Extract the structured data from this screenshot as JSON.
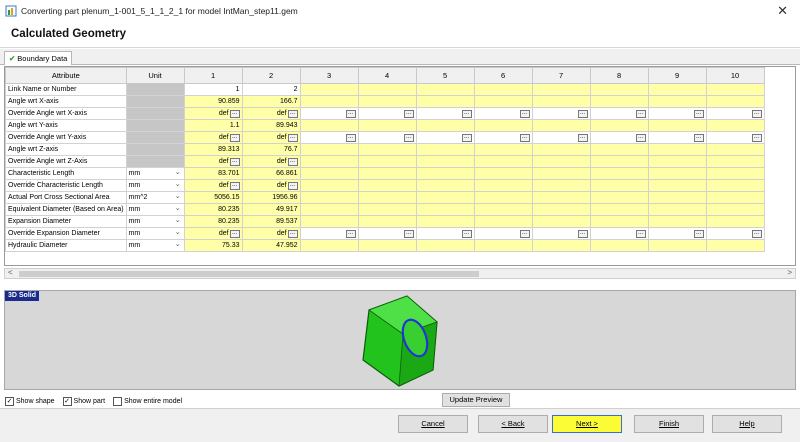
{
  "window": {
    "title": "Converting part plenum_1-001_5_1_1_2_1 for model IntMan_step11.gem",
    "close_glyph": "✕"
  },
  "page_title": "Calculated Geometry",
  "tab": {
    "check": "✔",
    "label": "Boundary Data"
  },
  "grid": {
    "headers": {
      "attribute": "Attribute",
      "unit": "Unit",
      "columns": [
        "1",
        "2",
        "3",
        "4",
        "5",
        "6",
        "7",
        "8",
        "9",
        "10"
      ]
    },
    "def_label": "def",
    "ellipsis": "...",
    "dropdown_glyph": "⌄",
    "rows": [
      {
        "label": "Link Name or Number",
        "unit": null,
        "kind": "white",
        "v1": "1",
        "v2": "2",
        "extra_buttons": false
      },
      {
        "label": "Angle wrt X-axis",
        "unit": null,
        "kind": "yellow",
        "v1": "90.859",
        "v2": "166.7",
        "extra_buttons": false
      },
      {
        "label": "Override Angle wrt X-axis",
        "unit": null,
        "kind": "override",
        "v1": null,
        "v2": null,
        "extra_buttons": true
      },
      {
        "label": "Angle wrt Y-axis",
        "unit": null,
        "kind": "yellow",
        "v1": "1.1",
        "v2": "89.943",
        "extra_buttons": false
      },
      {
        "label": "Override Angle wrt Y-axis",
        "unit": null,
        "kind": "override",
        "v1": null,
        "v2": null,
        "extra_buttons": true
      },
      {
        "label": "Angle wrt Z-axis",
        "unit": null,
        "kind": "yellow",
        "v1": "89.313",
        "v2": "76.7",
        "extra_buttons": false
      },
      {
        "label": "Override Angle wrt Z-Axis",
        "unit": null,
        "kind": "override",
        "v1": null,
        "v2": null,
        "extra_buttons": false
      },
      {
        "label": "Characteristic Length",
        "unit": "mm",
        "kind": "yellow",
        "v1": "83.701",
        "v2": "66.861",
        "extra_buttons": false
      },
      {
        "label": "Override Characteristic Length",
        "unit": "mm",
        "kind": "override",
        "v1": null,
        "v2": null,
        "extra_buttons": false
      },
      {
        "label": "Actual Port Cross Sectional Area",
        "unit": "mm^2",
        "kind": "yellow",
        "v1": "5056.15",
        "v2": "1956.96",
        "extra_buttons": false
      },
      {
        "label": "Equivalent Diameter (Based on Area)",
        "unit": "mm",
        "kind": "yellow",
        "v1": "80.235",
        "v2": "49.917",
        "extra_buttons": false
      },
      {
        "label": "Expansion Diameter",
        "unit": "mm",
        "kind": "yellow",
        "v1": "80.235",
        "v2": "89.537",
        "extra_buttons": false
      },
      {
        "label": "Override Expansion Diameter",
        "unit": "mm",
        "kind": "override",
        "v1": null,
        "v2": null,
        "extra_buttons": true
      },
      {
        "label": "Hydraulic Diameter",
        "unit": "mm",
        "kind": "yellow",
        "v1": "75.33",
        "v2": "47.952",
        "extra_buttons": false
      }
    ]
  },
  "scrollbar": {
    "left": "<",
    "right": ">"
  },
  "solid_view": {
    "label": "3D Solid",
    "shape_color": "#22c31c",
    "port_color": "#1f36d6"
  },
  "options": {
    "show_shape": {
      "label": "Show shape",
      "checked": true
    },
    "show_part": {
      "label": "Show part",
      "checked": true
    },
    "show_entire_model": {
      "label": "Show entire model",
      "checked": false
    }
  },
  "update_preview": "Update Preview",
  "footer": {
    "cancel": "Cancel",
    "back": "< Back",
    "next": "Next >",
    "finish": "Finish",
    "help": "Help"
  }
}
